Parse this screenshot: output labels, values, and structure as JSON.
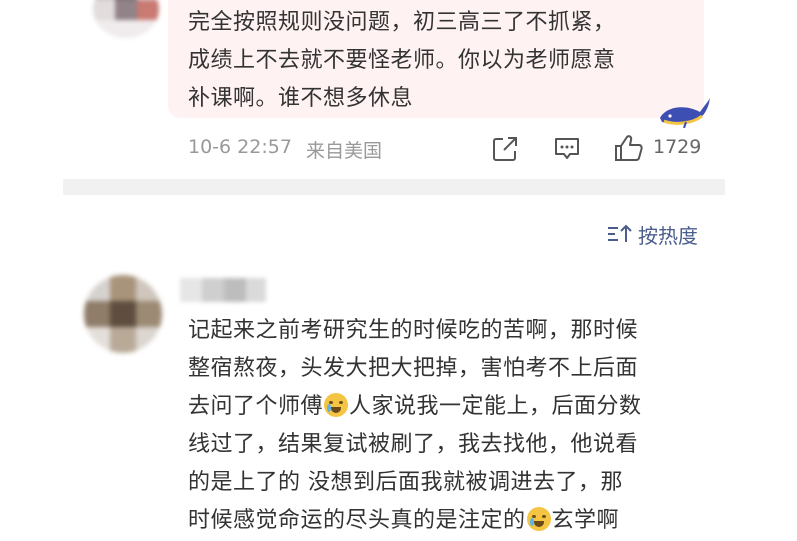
{
  "top_comment": {
    "text_lines": [
      "完全按照规则没问题，初三高三了不抓紧，",
      "成绩上不去就不要怪老师。你以为老师愿意",
      "补课啊。谁不想多休息"
    ],
    "time": "10-6 22:57",
    "location": "来自美国",
    "like_count": "1729",
    "icons": {
      "share": "share-icon",
      "comment": "comment-icon",
      "like": "like-icon",
      "badge": "whale-icon"
    }
  },
  "sort": {
    "label": "按热度",
    "icon": "sort-icon"
  },
  "second_comment": {
    "text_lines": [
      "记起来之前考研究生的时候吃的苦啊，那时候",
      "整宿熬夜，头发大把大把掉，害怕考不上后面"
    ],
    "line3_before": "去问了个师傅",
    "emoji1": "crying-emoji",
    "line3_after": "人家说我一定能上，后面分数",
    "line4": "线过了，结果复试被刷了，我去找他，他说看",
    "line5": "的是上了的 没想到后面我就被调进去了，那",
    "line6_before": "时候感觉命运的尽头真的是注定的",
    "emoji2": "laughing-crying-emoji",
    "line6_after": "玄学啊"
  },
  "colors": {
    "accent": "#4a5d8c",
    "bubble": "#fff2f2",
    "meta": "#999999",
    "divider": "#f1f1f1"
  }
}
